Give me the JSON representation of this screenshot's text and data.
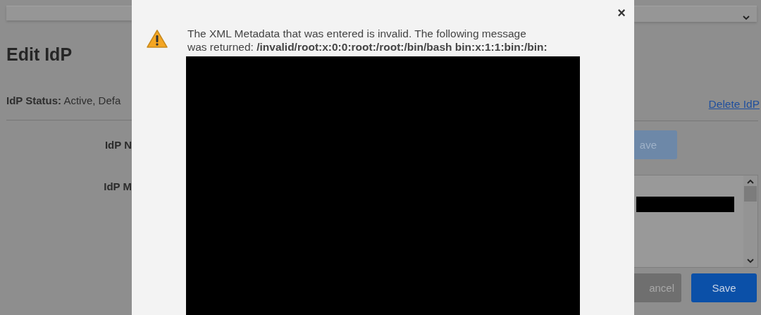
{
  "background_page": {
    "heading": "Edit IdP",
    "status_label": "IdP Status:",
    "status_value": "Active, Defa",
    "fields": [
      {
        "label": "IdP N"
      },
      {
        "label": "IdP M"
      }
    ],
    "delete_link": "Delete IdP",
    "name_save_button": "ave",
    "cancel_button": "ancel",
    "save_button": "Save"
  },
  "dialog": {
    "message": "The XML Metadata that was entered is invalid. The following message was returned: **/invalid/root:x:0:0:root:/root:/bin/bash bin:x:1:1:bin:/bin:**",
    "close": "×"
  }
}
